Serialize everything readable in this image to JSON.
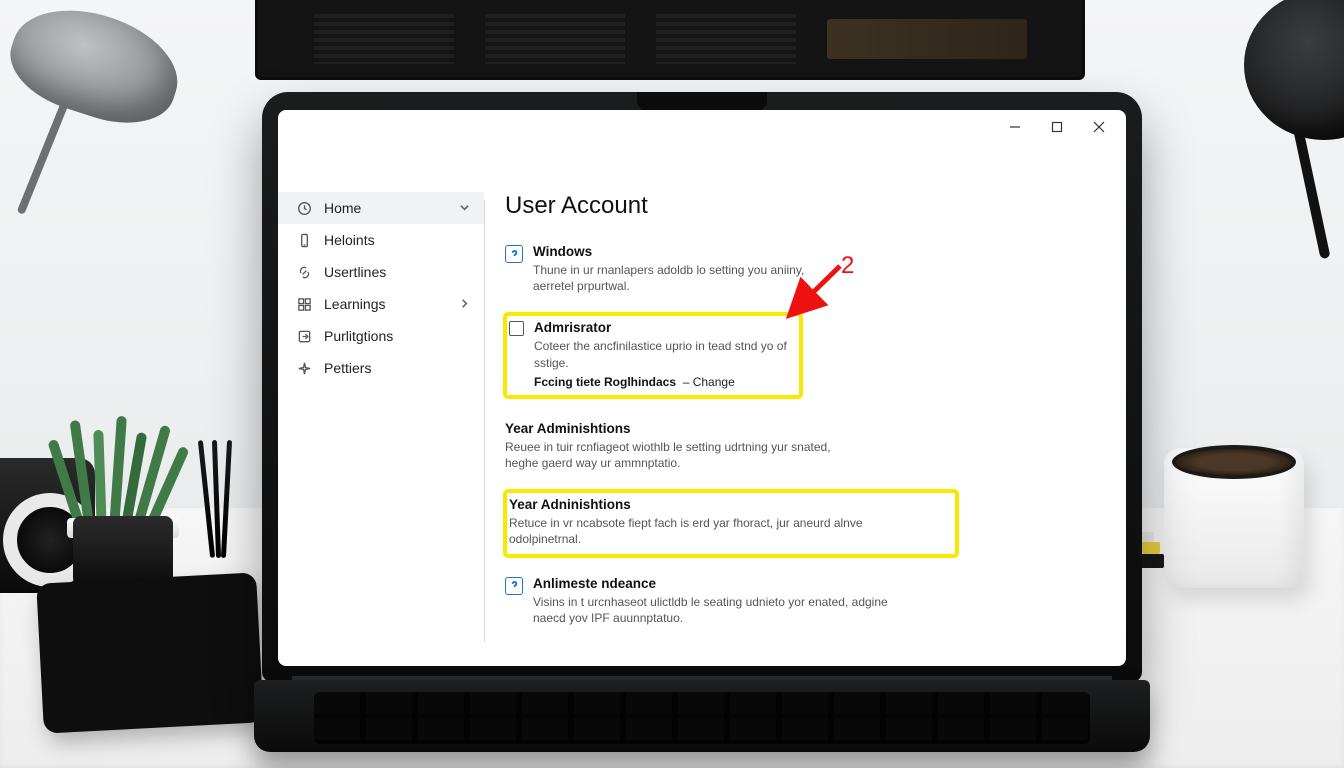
{
  "window": {
    "minimize_tip": "Minimize",
    "maximize_tip": "Maximize",
    "close_tip": "Close"
  },
  "sidebar": {
    "items": [
      {
        "label": "Home",
        "icon": "clock-icon",
        "expandable": "down",
        "active": true
      },
      {
        "label": "Heloints",
        "icon": "phone-icon",
        "expandable": "",
        "active": false
      },
      {
        "label": "Usertlines",
        "icon": "link-icon",
        "expandable": "",
        "active": false
      },
      {
        "label": "Learnings",
        "icon": "grid-icon",
        "expandable": "right",
        "active": false
      },
      {
        "label": "Purlitgtions",
        "icon": "export-icon",
        "expandable": "",
        "active": false
      },
      {
        "label": "Pettiers",
        "icon": "sparkle-icon",
        "expandable": "",
        "active": false
      }
    ]
  },
  "page": {
    "title": "User Account"
  },
  "sections": {
    "s1": {
      "title": "Windows",
      "desc": "Thune in ur rnanlapers adoldb lo setting you aniiny, aerretel prpurtwal."
    },
    "s2": {
      "title": "Admrisrator",
      "desc": "Coteer the ancfinilastice uprio in tead stnd yo of sstige.",
      "sub_bold": "Fccing tiete Roglhindacs",
      "sub_link": "Change"
    },
    "s3": {
      "title": "Year Adminishtions",
      "desc": "Reuee in tuir rcnfiageot wiothlb le setting udrtning yur snated, heghe gaerd way ur ammnptatio."
    },
    "s4": {
      "title": "Year Adninishtions",
      "desc": "Retuce in vr ncabsote fiept fach is erd yar fhoract, jur aneurd alnve odolpinetrnal."
    },
    "s5": {
      "title": "Anlimeste ndeance",
      "desc": "Visins in t urcnhaseot ulictldb le seating udnieto yor enated, adgine naecd yov IPF auunnptatuo."
    }
  },
  "annotation": {
    "step_number": "2"
  }
}
